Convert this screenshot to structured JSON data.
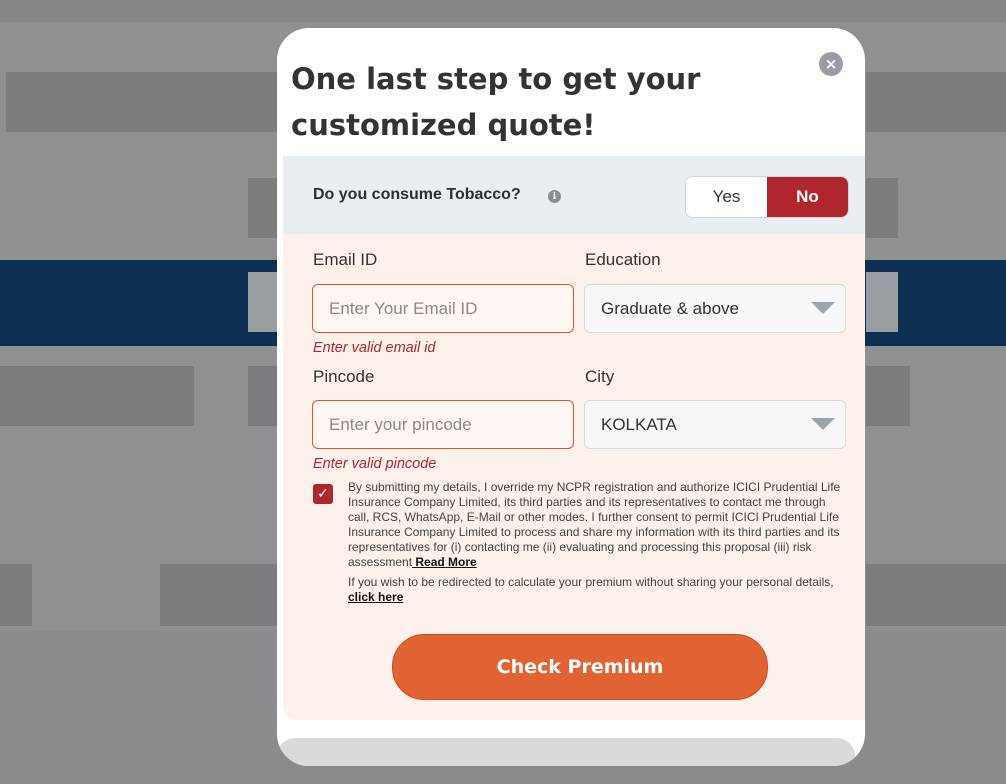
{
  "modal": {
    "title": "One last step to get your customized quote!",
    "close_symbol": "×"
  },
  "tobacco": {
    "question": "Do you consume Tobacco?",
    "info_symbol": "i",
    "options": [
      "Yes",
      "No"
    ],
    "selected": "No"
  },
  "form": {
    "email": {
      "label": "Email ID",
      "placeholder": "Enter Your Email ID",
      "value": "",
      "error": "Enter valid email id"
    },
    "education": {
      "label": "Education",
      "value": "Graduate & above"
    },
    "pincode": {
      "label": "Pincode",
      "placeholder": "Enter your pincode",
      "value": "",
      "error": "Enter valid pincode"
    },
    "city": {
      "label": "City",
      "value": "KOLKATA"
    }
  },
  "consent": {
    "checked": true,
    "check_symbol": "✓",
    "text": "By submitting my details, I override my NCPR registration and authorize ICICI Prudential Life Insurance Company Limited, its third parties and its representatives to contact me through call, RCS, WhatsApp, E-Mail or other modes. I further consent to permit ICICI Prudential Life Insurance Company Limited to process and share my information with its third parties and its representatives for (i) contacting me (ii) evaluating and processing this proposal (iii) risk assessment",
    "read_more": " Read More",
    "redirect_text": "If you wish to be redirected to calculate your premium without sharing your personal details,",
    "click_here": "click here"
  },
  "cta": {
    "label": "Check Premium"
  },
  "colors": {
    "accent_orange": "#e16333",
    "accent_red": "#b0262f",
    "tobacco_bg": "#e9eef2",
    "form_bg": "#fdf1ec"
  }
}
